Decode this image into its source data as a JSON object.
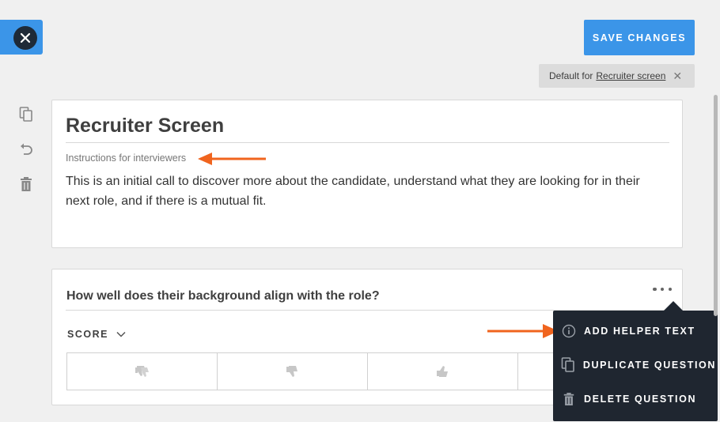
{
  "header": {
    "save_label": "SAVE CHANGES",
    "default_prefix": "Default for",
    "default_link": "Recruiter screen"
  },
  "card": {
    "title": "Recruiter Screen",
    "instructions_label": "Instructions for interviewers",
    "instructions_text": "This is an initial call to discover more about the candidate, understand what they are looking for in their next role, and if there is a mutual fit."
  },
  "question": {
    "text": "How well does their background align with the role?",
    "score_label": "SCORE",
    "ratings": [
      "strong-no-icon",
      "no-icon",
      "yes-icon",
      "strong-yes-icon"
    ]
  },
  "menu": {
    "items": [
      {
        "label": "ADD HELPER TEXT",
        "icon": "info-icon"
      },
      {
        "label": "DUPLICATE QUESTION",
        "icon": "duplicate-icon"
      },
      {
        "label": "DELETE QUESTION",
        "icon": "trash-icon"
      }
    ]
  },
  "colors": {
    "accent": "#3b95e8",
    "arrow": "#f0641e",
    "menu_bg": "#1f2630",
    "page_bg": "#f0f0f0"
  }
}
